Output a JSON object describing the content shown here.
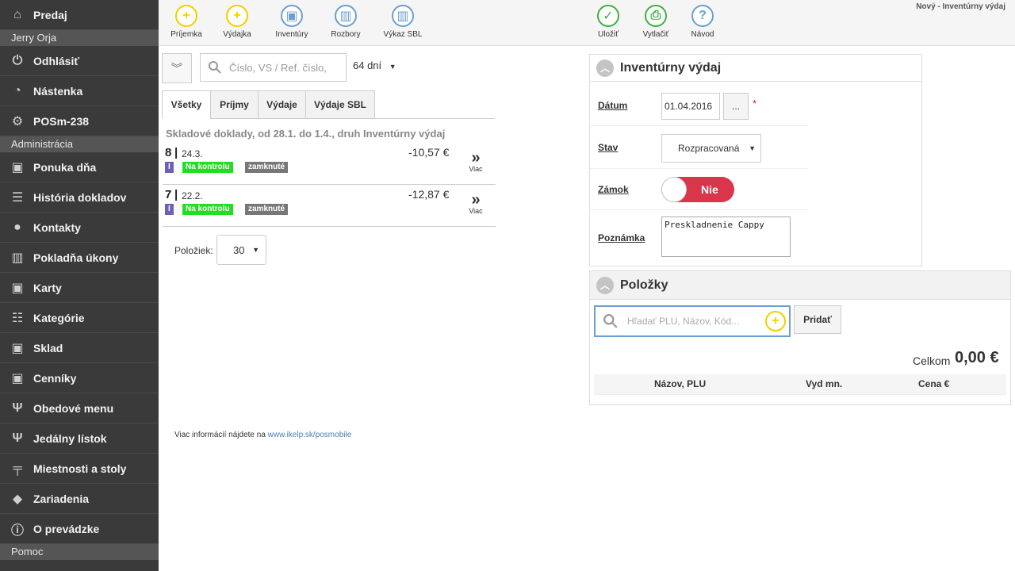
{
  "window_title": "Nový - Inventúrny výdaj",
  "sidebar": {
    "top": {
      "label": "Predaj",
      "icon": "home-icon"
    },
    "user_section": "Jerry Orja",
    "user_items": [
      {
        "label": "Odhlásiť",
        "icon": "power-icon"
      },
      {
        "label": "Nástenka",
        "icon": "dashboard-icon"
      },
      {
        "label": "POSm-238",
        "icon": "gear-icon"
      }
    ],
    "admin_section": "Administrácia",
    "admin_items": [
      {
        "label": "Ponuka dňa",
        "icon": "boxes-star-icon"
      },
      {
        "label": "História dokladov",
        "icon": "list-icon"
      },
      {
        "label": "Kontakty",
        "icon": "users-icon"
      },
      {
        "label": "Pokladňa úkony",
        "icon": "bar-chart-icon"
      },
      {
        "label": "Karty",
        "icon": "boxes-icon"
      },
      {
        "label": "Kategórie",
        "icon": "tree-icon"
      },
      {
        "label": "Sklad",
        "icon": "boxes-icon"
      },
      {
        "label": "Cenníky",
        "icon": "boxes-icon"
      },
      {
        "label": "Obedové menu",
        "icon": "cutlery-icon"
      },
      {
        "label": "Jedálny lístok",
        "icon": "cutlery-icon"
      },
      {
        "label": "Miestnosti a stoly",
        "icon": "table-icon"
      },
      {
        "label": "Zariadenia",
        "icon": "diamond-icon"
      },
      {
        "label": "O prevádzke",
        "icon": "info-icon"
      }
    ],
    "help_section": "Pomoc"
  },
  "toolbar": {
    "left": [
      {
        "label": "Príjemka",
        "icon": "plus-icon",
        "color": "#f0d000"
      },
      {
        "label": "Výdajka",
        "icon": "plus-icon",
        "color": "#f0d000"
      },
      {
        "label": "Inventúry",
        "icon": "boxes-icon",
        "color": "#6a9fd0"
      },
      {
        "label": "Rozbory",
        "icon": "bar-chart-icon",
        "color": "#6a9fd0"
      },
      {
        "label": "Výkaz SBL",
        "icon": "bar-chart-icon",
        "color": "#6a9fd0"
      }
    ],
    "right": [
      {
        "label": "Uložiť",
        "icon": "check-icon",
        "color": "#3db03d"
      },
      {
        "label": "Vytlačiť",
        "icon": "printer-icon",
        "color": "#3db03d"
      },
      {
        "label": "Návod",
        "icon": "question-icon",
        "color": "#6a9fd0"
      }
    ]
  },
  "list": {
    "search_placeholder": "Číslo, VS / Ref. číslo,",
    "days": "64 dní",
    "tabs": [
      "Všetky",
      "Príjmy",
      "Výdaje",
      "Výdaje SBL"
    ],
    "caption": "Skladové doklady, od 28.1. do 1.4., druh Inventúrny výdaj",
    "docs": [
      {
        "num": "8",
        "date": "24.3.",
        "amount": "-10,57 €",
        "badge_i": "I",
        "badge_ctrl": "Na kontrolu",
        "badge_lock": "zamknuté",
        "more": "Viac"
      },
      {
        "num": "7",
        "date": "22.2.",
        "amount": "-12,87 €",
        "badge_i": "I",
        "badge_ctrl": "Na kontrolu",
        "badge_lock": "zamknuté",
        "more": "Viac"
      }
    ],
    "per_page_label": "Položiek:",
    "per_page": "30",
    "info_text": "Viac informácií nájdete na ",
    "info_link": "www.ikelp.sk/posmobile"
  },
  "form": {
    "title": "Inventúrny výdaj",
    "date_label": "Dátum",
    "date_value": "01.04.2016",
    "date_btn": "...",
    "required": "*",
    "state_label": "Stav",
    "state_value": "Rozpracovaná",
    "lock_label": "Zámok",
    "lock_value": "Nie",
    "note_label": "Poznámka",
    "note_value": "Preskladnenie Cappy"
  },
  "items": {
    "title": "Položky",
    "search_placeholder": "Hľadať PLU, Názov, Kód...",
    "add_label": "Pridať",
    "total_label": "Celkom",
    "total_value": "0,00 €",
    "columns": [
      "Názov, PLU",
      "Vyd mn.",
      "Cena €"
    ]
  }
}
